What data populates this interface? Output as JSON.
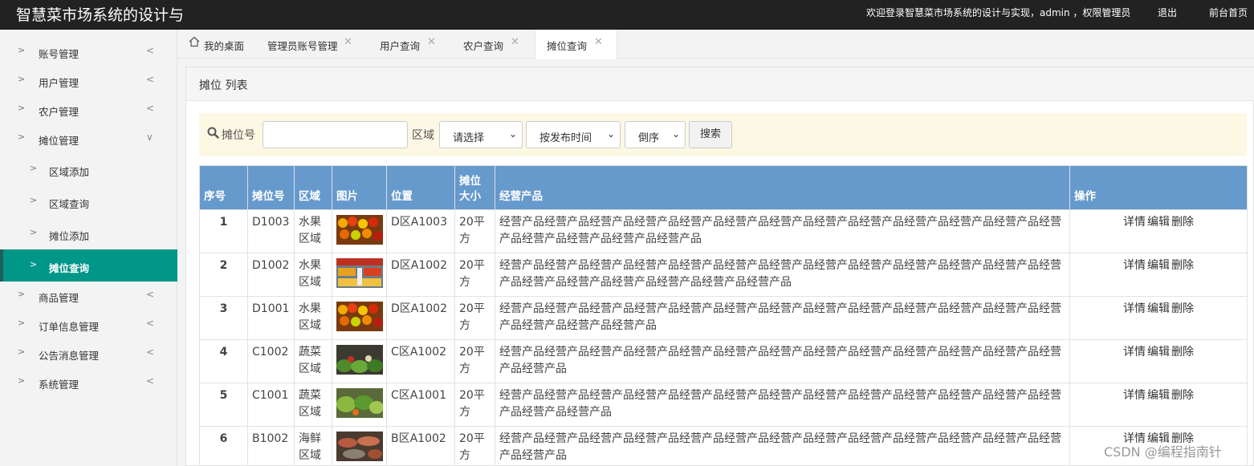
{
  "header": {
    "title": "智慧菜市场系统的设计与",
    "welcome": "欢迎登录智慧菜市场系统的设计与实现，admin ，权限管理员",
    "logout": "退出",
    "front_home": "前台首页"
  },
  "sidebar": {
    "items": [
      {
        "label": "账号管理"
      },
      {
        "label": "用户管理"
      },
      {
        "label": "农户管理"
      },
      {
        "label": "摊位管理"
      },
      {
        "label": "商品管理"
      },
      {
        "label": "订单信息管理"
      },
      {
        "label": "公告消息管理"
      },
      {
        "label": "系统管理"
      }
    ],
    "subitems": [
      {
        "label": "区域添加"
      },
      {
        "label": "区域查询"
      },
      {
        "label": "摊位添加"
      },
      {
        "label": "摊位查询"
      }
    ]
  },
  "tabs": [
    {
      "label": "我的桌面"
    },
    {
      "label": "管理员账号管理"
    },
    {
      "label": "用户查询"
    },
    {
      "label": "农户查询"
    },
    {
      "label": "摊位查询"
    }
  ],
  "panel": {
    "title": "摊位 列表"
  },
  "search": {
    "stall_label": "摊位号",
    "stall_value": "",
    "area_label": "区域",
    "area_selected": "请选择",
    "sort_field": "按发布时间",
    "sort_order": "倒序",
    "button": "搜索"
  },
  "table": {
    "headers": {
      "index": "序号",
      "stall_no": "摊位号",
      "area": "区域",
      "image": "图片",
      "location": "位置",
      "size": "摊位大小",
      "products": "经营产品",
      "ops": "操作"
    },
    "ops": {
      "detail": "详情",
      "edit": "编辑",
      "delete": "删除"
    },
    "rows": [
      {
        "index": "1",
        "stall_no": "D1003",
        "area": "水果区域",
        "location": "D区A1003",
        "size": "20平方",
        "products": "经营产品经营产品经营产品经营产品经营产品经营产品经营产品经营产品经营产品经营产品经营产品经营产品经营产品经营产品经营产品经营产品经营产品"
      },
      {
        "index": "2",
        "stall_no": "D1002",
        "area": "水果区域",
        "location": "D区A1002",
        "size": "20平方",
        "products": "经营产品经营产品经营产品经营产品经营产品经营产品经营产品经营产品经营产品经营产品经营产品经营产品经营产品经营产品经营产品经营产品经营产品经营产品经营产品"
      },
      {
        "index": "3",
        "stall_no": "D1001",
        "area": "水果区域",
        "location": "D区A1002",
        "size": "20平方",
        "products": "经营产品经营产品经营产品经营产品经营产品经营产品经营产品经营产品经营产品经营产品经营产品经营产品经营产品经营产品经营产品经营产品"
      },
      {
        "index": "4",
        "stall_no": "C1002",
        "area": "蔬菜区域",
        "location": "C区A1002",
        "size": "20平方",
        "products": "经营产品经营产品经营产品经营产品经营产品经营产品经营产品经营产品经营产品经营产品经营产品经营产品经营产品经营产品"
      },
      {
        "index": "5",
        "stall_no": "C1001",
        "area": "蔬菜区域",
        "location": "C区A1001",
        "size": "20平方",
        "products": "经营产品经营产品经营产品经营产品经营产品经营产品经营产品经营产品经营产品经营产品经营产品经营产品经营产品经营产品经营产品"
      },
      {
        "index": "6",
        "stall_no": "B1002",
        "area": "海鲜区域",
        "location": "B区A1002",
        "size": "20平方",
        "products": "经营产品经营产品经营产品经营产品经营产品经营产品经营产品经营产品经营产品经营产品经营产品经营产品经营产品经营产品"
      }
    ]
  },
  "watermark": "CSDN @编程指南针",
  "colors": {
    "topbar": "#222222",
    "active_menu": "#009688",
    "table_header": "#6699cc",
    "search_bg": "#fdf8e4"
  }
}
